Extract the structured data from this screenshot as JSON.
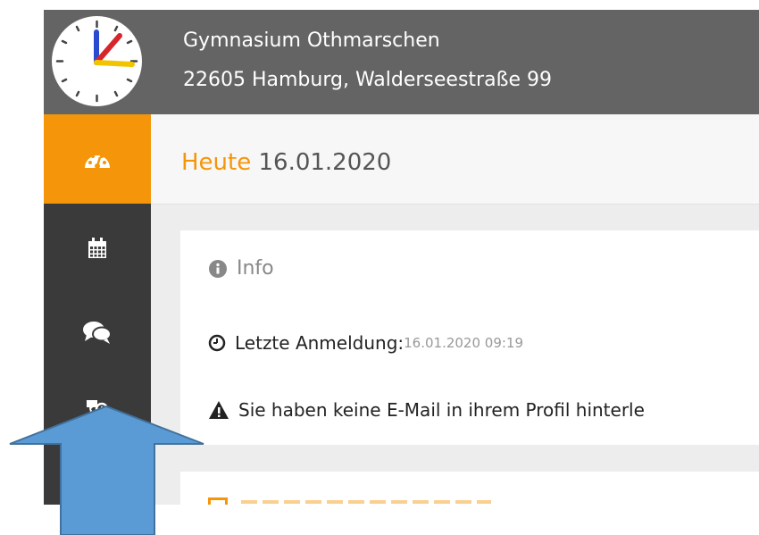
{
  "header": {
    "school_name": "Gymnasium Othmarschen",
    "school_address": "22605 Hamburg, Walderseestraße 99"
  },
  "sidebar": {
    "items": [
      {
        "icon": "dashboard-icon",
        "active": true
      },
      {
        "icon": "calendar-icon",
        "active": false
      },
      {
        "icon": "chat-icon",
        "active": false
      },
      {
        "icon": "phone-contact-icon",
        "active": false
      }
    ]
  },
  "today": {
    "label": "Heute",
    "date": "16.01.2020"
  },
  "info": {
    "title": "Info",
    "last_login_label": "Letzte Anmeldung:",
    "last_login_value": "16.01.2020 09:19",
    "warning": "Sie haben keine E-Mail in ihrem Profil hinterle"
  },
  "colors": {
    "accent": "#f5960a",
    "header_bg": "#646464",
    "sidebar_bg": "#3a3a3a",
    "arrow": "#5b9bd5"
  }
}
